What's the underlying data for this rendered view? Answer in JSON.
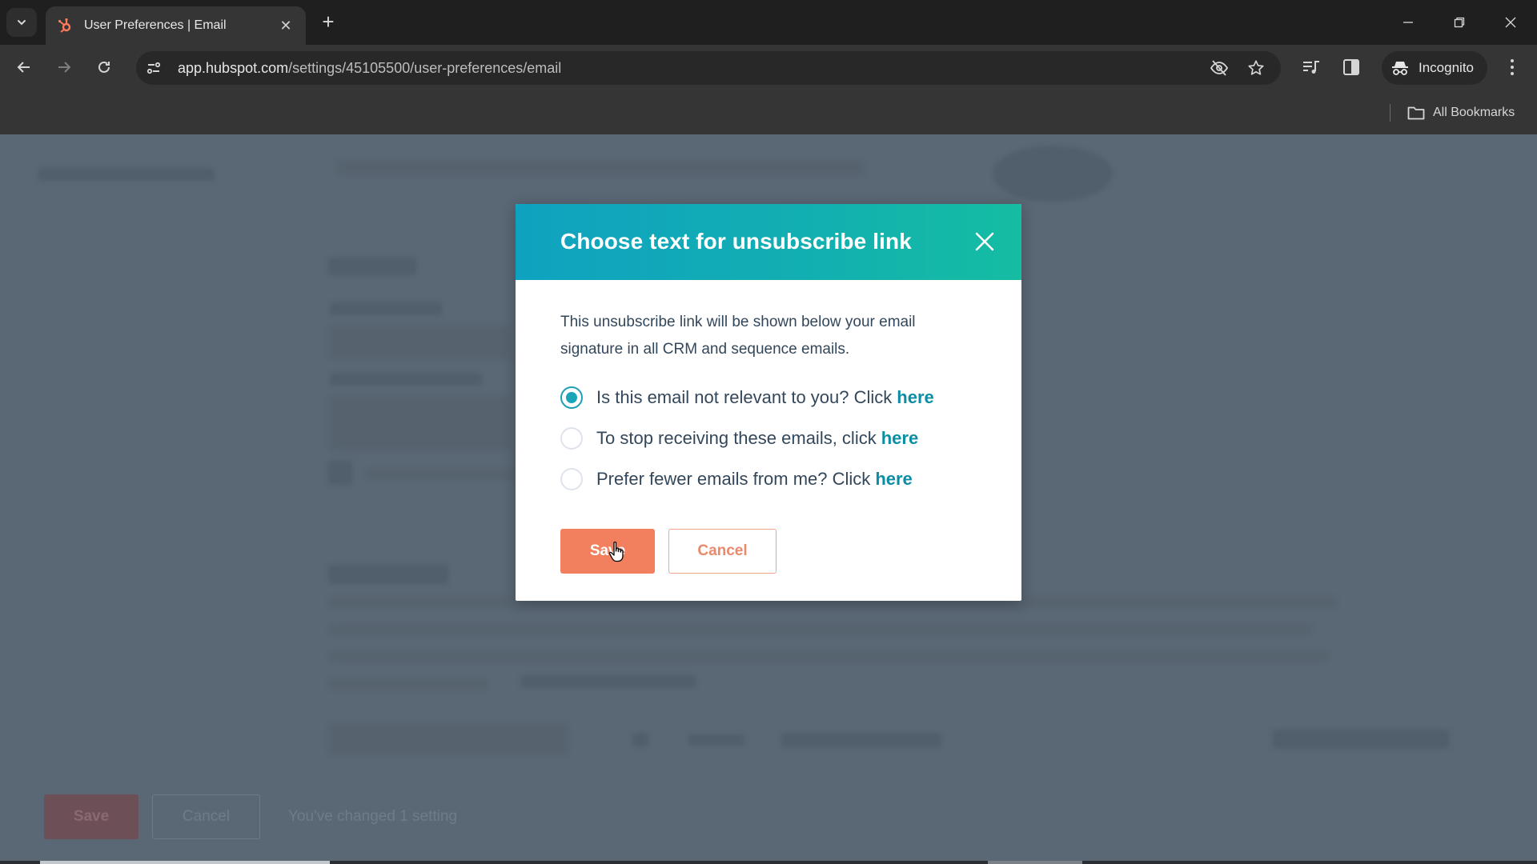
{
  "browser": {
    "tab": {
      "title": "User Preferences | Email",
      "favicon": "hubspot-sprocket-icon",
      "close_glyph": "✕"
    },
    "new_tab_glyph": "+",
    "address_bar": {
      "url_host": "app.hubspot.com",
      "url_path": "/settings/45105500/user-preferences/email"
    },
    "profile_label": "Incognito",
    "bookmarks_label": "All Bookmarks",
    "window_controls": {
      "minimize": "—",
      "restore": "❐",
      "close": "✕"
    }
  },
  "background_page": {
    "footer": {
      "save_label": "Save",
      "cancel_label": "Cancel",
      "status_text": "You've changed 1 setting"
    }
  },
  "dialog": {
    "title": "Choose text for unsubscribe link",
    "description": "This unsubscribe link will be shown below your email signature in all CRM and sequence emails.",
    "options": [
      {
        "text": "Is this email not relevant to you? Click",
        "link": "here",
        "checked": true
      },
      {
        "text": "To stop receiving these emails, click",
        "link": "here",
        "checked": false
      },
      {
        "text": "Prefer fewer emails from me? Click",
        "link": "here",
        "checked": false
      }
    ],
    "save_label": "Save",
    "cancel_label": "Cancel"
  },
  "colors": {
    "header_gradient_start": "#0fa2c0",
    "header_gradient_end": "#15bda2",
    "primary_button": "#f2805f",
    "link": "#0b8ea4",
    "overlay": "#5a6774"
  }
}
